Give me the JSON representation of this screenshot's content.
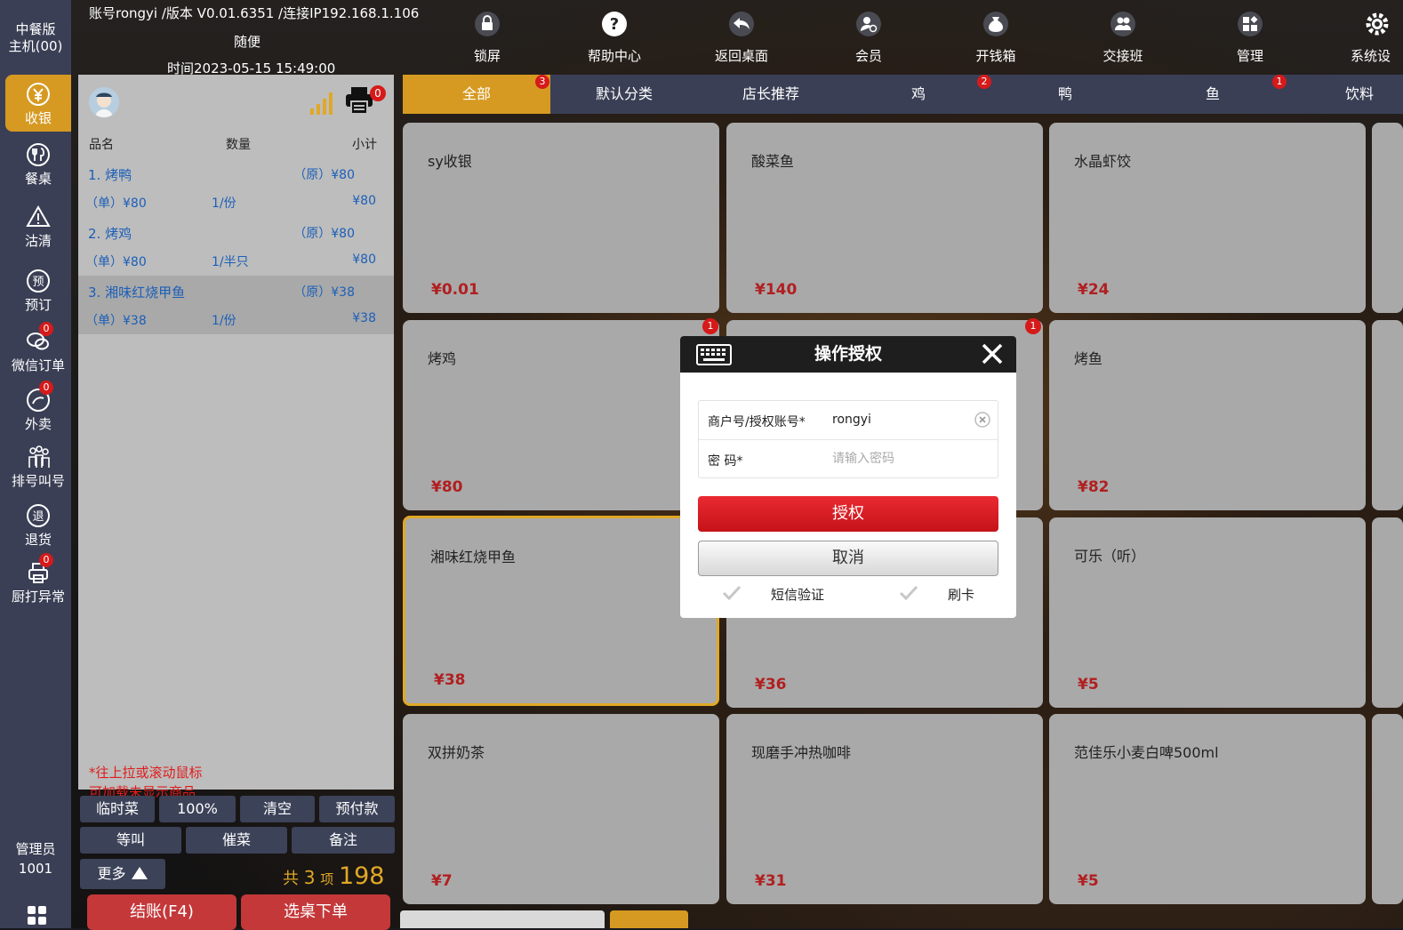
{
  "sidebar": {
    "brand_line1": "中餐版",
    "brand_line2": "主机(00)",
    "items": [
      {
        "label": "收银",
        "icon": "yen-circle-icon"
      },
      {
        "label": "餐桌",
        "icon": "fork-knife-icon"
      },
      {
        "label": "沽清",
        "icon": "warning-icon"
      },
      {
        "label": "预订",
        "icon": "reserve-icon"
      },
      {
        "label": "微信订单",
        "icon": "wechat-icon",
        "badge": "0"
      },
      {
        "label": "外卖",
        "icon": "takeout-icon",
        "badge": "0"
      },
      {
        "label": "排号叫号",
        "icon": "queue-icon"
      },
      {
        "label": "退货",
        "icon": "return-icon"
      },
      {
        "label": "厨打异常",
        "icon": "kitchen-printer-icon",
        "badge": "0"
      }
    ],
    "admin_label": "管理员",
    "admin_id": "1001"
  },
  "topbar": {
    "info_line1": "账号rongyi /版本 V0.01.6351 /连接IP192.168.1.106",
    "info_line2": "随便",
    "info_line3": "时间2023-05-15 15:49:00",
    "menu": [
      {
        "label": "锁屏",
        "icon": "lock-icon"
      },
      {
        "label": "帮助中心",
        "icon": "help-icon"
      },
      {
        "label": "返回桌面",
        "icon": "back-icon"
      },
      {
        "label": "会员",
        "icon": "member-icon"
      },
      {
        "label": "开钱箱",
        "icon": "money-bag-icon"
      },
      {
        "label": "交接班",
        "icon": "handover-icon"
      },
      {
        "label": "管理",
        "icon": "manage-icon"
      },
      {
        "label": "系统设",
        "icon": "gear-icon"
      }
    ]
  },
  "order": {
    "printer_badge": "0",
    "col_name": "品名",
    "col_qty": "数量",
    "col_subtotal": "小计",
    "items": [
      {
        "name": "1. 烤鸭",
        "orig": "（原）¥80",
        "unit": "（单）¥80",
        "qty": "1/份",
        "subtotal": "¥80"
      },
      {
        "name": "2. 烤鸡",
        "orig": "（原）¥80",
        "unit": "（单）¥80",
        "qty": "1/半只",
        "subtotal": "¥80"
      },
      {
        "name": "3. 湘味红烧甲鱼",
        "orig": "（原）¥38",
        "unit": "（单）¥38",
        "qty": "1/份",
        "subtotal": "¥38"
      }
    ],
    "hint_line1": "*往上拉或滚动鼠标",
    "hint_line2": "可加载未显示商品",
    "buttons_row1": [
      "临时菜",
      "100%",
      "清空",
      "预付款"
    ],
    "buttons_row2": [
      "等叫",
      "催菜",
      "备注"
    ],
    "more_label": "更多",
    "total_prefix": "共",
    "total_count": "3",
    "total_unit": "项",
    "total_amount": "198",
    "btn_checkout": "结账(F4)",
    "btn_order": "选桌下单"
  },
  "tabs": [
    {
      "label": "全部",
      "badge": "3"
    },
    {
      "label": "默认分类",
      "badge": ""
    },
    {
      "label": "店长推荐",
      "badge": ""
    },
    {
      "label": "鸡",
      "badge": "2"
    },
    {
      "label": "鸭",
      "badge": ""
    },
    {
      "label": "鱼",
      "badge": "1"
    },
    {
      "label": "饮料",
      "badge": ""
    }
  ],
  "dishes": [
    {
      "name": "sy收银",
      "price": "¥0.01"
    },
    {
      "name": "酸菜鱼",
      "price": "¥140"
    },
    {
      "name": "水晶虾饺",
      "price": "¥24"
    },
    {
      "name": "烤鸡",
      "price": "¥80",
      "badge": "1"
    },
    {
      "name": "",
      "price": "",
      "badge": "1"
    },
    {
      "name": "烤鱼",
      "price": "¥82"
    },
    {
      "name": "湘味红烧甲鱼",
      "price": "¥38"
    },
    {
      "name": "",
      "price": "¥36"
    },
    {
      "name": "可乐（听）",
      "price": "¥5"
    },
    {
      "name": "双拼奶茶",
      "price": "¥7"
    },
    {
      "name": "现磨手冲热咖啡",
      "price": "¥31"
    },
    {
      "name": "范佳乐小麦白啤500ml",
      "price": "¥5"
    }
  ],
  "dialog": {
    "title": "操作授权",
    "account_label": "商户号/授权账号*",
    "account_value": "rongyi",
    "password_label": "密 码*",
    "password_placeholder": "请输入密码",
    "btn_auth": "授权",
    "btn_cancel": "取消",
    "opt_sms": "短信验证",
    "opt_card": "刷卡"
  },
  "colors": {
    "accent": "#d69a22",
    "sidebar": "#3a3f55",
    "price": "#b11f20",
    "badge": "#d61a1a",
    "auth_button": "#e01c24"
  }
}
